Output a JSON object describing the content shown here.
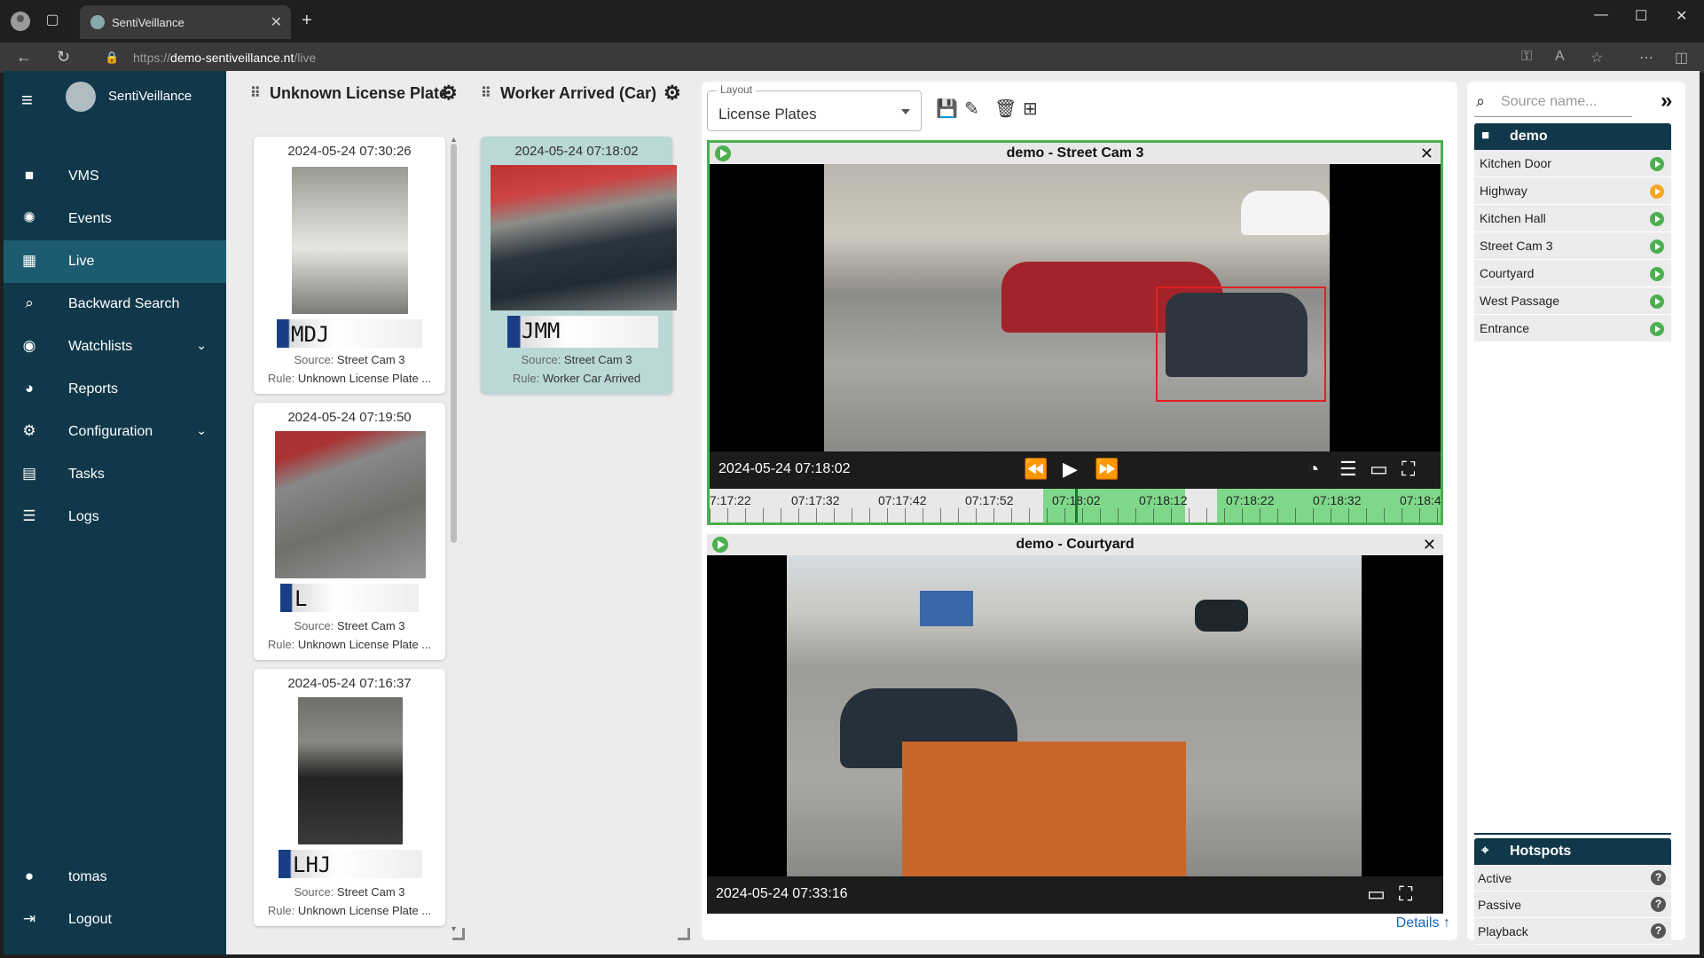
{
  "browser": {
    "tab_title": "SentiVeillance",
    "url_prefix": "https://",
    "url_host": "demo-sentiveillance.nt",
    "url_path": "/live"
  },
  "sidebar": {
    "brand": "SentiVeillance",
    "items": [
      {
        "label": "VMS",
        "icon": "video-camera-icon"
      },
      {
        "label": "Events",
        "icon": "aperture-icon"
      },
      {
        "label": "Live",
        "icon": "dashboard-icon",
        "active": true
      },
      {
        "label": "Backward Search",
        "icon": "search-icon"
      },
      {
        "label": "Watchlists",
        "icon": "eye-icon",
        "expandable": true
      },
      {
        "label": "Reports",
        "icon": "pie-chart-icon"
      },
      {
        "label": "Configuration",
        "icon": "gear-icon",
        "expandable": true
      },
      {
        "label": "Tasks",
        "icon": "clipboard-icon"
      },
      {
        "label": "Logs",
        "icon": "list-icon"
      }
    ],
    "user": "tomas",
    "logout": "Logout"
  },
  "event_columns": [
    {
      "title": "Unknown License Plate",
      "cards": [
        {
          "timestamp": "2024-05-24 07:30:26",
          "plate": "MDJ",
          "source_label": "Source:",
          "source": "Street Cam 3",
          "rule_label": "Rule:",
          "rule": "Unknown License Plate ..."
        },
        {
          "timestamp": "2024-05-24 07:19:50",
          "plate": "L",
          "source_label": "Source:",
          "source": "Street Cam 3",
          "rule_label": "Rule:",
          "rule": "Unknown License Plate ..."
        },
        {
          "timestamp": "2024-05-24 07:16:37",
          "plate": "LHJ",
          "source_label": "Source:",
          "source": "Street Cam 3",
          "rule_label": "Rule:",
          "rule": "Unknown License Plate ..."
        }
      ]
    },
    {
      "title": "Worker Arrived (Car)",
      "cards": [
        {
          "timestamp": "2024-05-24 07:18:02",
          "plate": "JMM",
          "source_label": "Source:",
          "source": "Street Cam 3",
          "rule_label": "Rule:",
          "rule": "Worker Car Arrived",
          "selected": true
        }
      ]
    }
  ],
  "layout": {
    "label": "Layout",
    "value": "License Plates"
  },
  "panes": [
    {
      "title": "demo - Street Cam 3",
      "timestamp": "2024-05-24 07:18:02",
      "timeline_labels": [
        "7:17:22",
        "07:17:32",
        "07:17:42",
        "07:17:52",
        "07:18:02",
        "07:18:12",
        "07:18:22",
        "07:18:32",
        "07:18:4"
      ]
    },
    {
      "title": "demo - Courtyard",
      "timestamp": "2024-05-24 07:33:16"
    }
  ],
  "details_link": "Details",
  "sources": {
    "search_placeholder": "Source name...",
    "group": "demo",
    "items": [
      {
        "name": "Kitchen Door",
        "status": "ok"
      },
      {
        "name": "Highway",
        "status": "paused"
      },
      {
        "name": "Kitchen Hall",
        "status": "ok"
      },
      {
        "name": "Street Cam 3",
        "status": "ok"
      },
      {
        "name": "Courtyard",
        "status": "ok"
      },
      {
        "name": "West Passage",
        "status": "ok"
      },
      {
        "name": "Entrance",
        "status": "ok"
      }
    ]
  },
  "hotspots": {
    "title": "Hotspots",
    "items": [
      "Active",
      "Passive",
      "Playback"
    ]
  },
  "colors": {
    "sidebar": "#10384a",
    "sidebar_active": "#1d5b70",
    "ok": "#4caf50",
    "paused": "#f5a623",
    "selected_card": "#b9d8d7",
    "link": "#1565c0"
  }
}
